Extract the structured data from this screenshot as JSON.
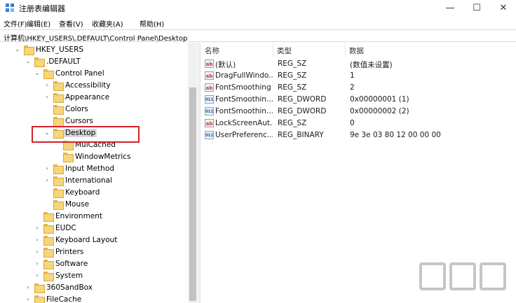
{
  "window": {
    "title": "注册表编辑器",
    "minimize_glyph": "—",
    "maximize_glyph": "☐",
    "close_glyph": "✕"
  },
  "menu": [
    {
      "label": "文件(F)"
    },
    {
      "label": "编辑(E)"
    },
    {
      "label": "查看(V)"
    },
    {
      "label": "收藏夹(A)"
    },
    {
      "label": "帮助(H)"
    }
  ],
  "address": {
    "path": "计算机\\HKEY_USERS\\.DEFAULT\\Control Panel\\Desktop"
  },
  "tree": [
    {
      "label": "HKEY_USERS",
      "expanded": true
    },
    {
      "label": ".DEFAULT",
      "expanded": true
    },
    {
      "label": "Control Panel",
      "expanded": true
    },
    {
      "label": "Accessibility",
      "expanded": false
    },
    {
      "label": "Appearance",
      "expanded": false
    },
    {
      "label": "Colors",
      "expanded": null
    },
    {
      "label": "Cursors",
      "expanded": null
    },
    {
      "label": "Desktop",
      "expanded": true,
      "selected": true
    },
    {
      "label": "MuiCached",
      "expanded": null
    },
    {
      "label": "WindowMetrics",
      "expanded": null
    },
    {
      "label": "Input Method",
      "expanded": false
    },
    {
      "label": "International",
      "expanded": false
    },
    {
      "label": "Keyboard",
      "expanded": null
    },
    {
      "label": "Mouse",
      "expanded": null
    },
    {
      "label": "Environment",
      "expanded": null
    },
    {
      "label": "EUDC",
      "expanded": false
    },
    {
      "label": "Keyboard Layout",
      "expanded": false
    },
    {
      "label": "Printers",
      "expanded": false
    },
    {
      "label": "Software",
      "expanded": false
    },
    {
      "label": "System",
      "expanded": false
    },
    {
      "label": "360SandBox",
      "expanded": false
    },
    {
      "label": "FileCache",
      "expanded": false
    }
  ],
  "tree_glyphs": {
    "expanded": "⌄",
    "collapsed": "›"
  },
  "list": {
    "columns": {
      "name": "名称",
      "type": "类型",
      "data": "数据"
    },
    "rows": [
      {
        "icon": "ab",
        "name": "(默认)",
        "type": "REG_SZ",
        "data": "(数值未设置)"
      },
      {
        "icon": "ab",
        "name": "DragFullWindo...",
        "type": "REG_SZ",
        "data": "1"
      },
      {
        "icon": "ab",
        "name": "FontSmoothing",
        "type": "REG_SZ",
        "data": "2"
      },
      {
        "icon": "011",
        "name": "FontSmoothin...",
        "type": "REG_DWORD",
        "data": "0x00000001 (1)"
      },
      {
        "icon": "011",
        "name": "FontSmoothin...",
        "type": "REG_DWORD",
        "data": "0x00000002 (2)"
      },
      {
        "icon": "ab",
        "name": "LockScreenAut...",
        "type": "REG_SZ",
        "data": "0"
      },
      {
        "icon": "011",
        "name": "UserPreferenc...",
        "type": "REG_BINARY",
        "data": "9e 3e 03 80 12 00 00 00"
      }
    ]
  },
  "colors": {
    "highlight_box": "#d4212a",
    "folder": "#f7d57a",
    "selected_bg": "#d9d9d9"
  }
}
